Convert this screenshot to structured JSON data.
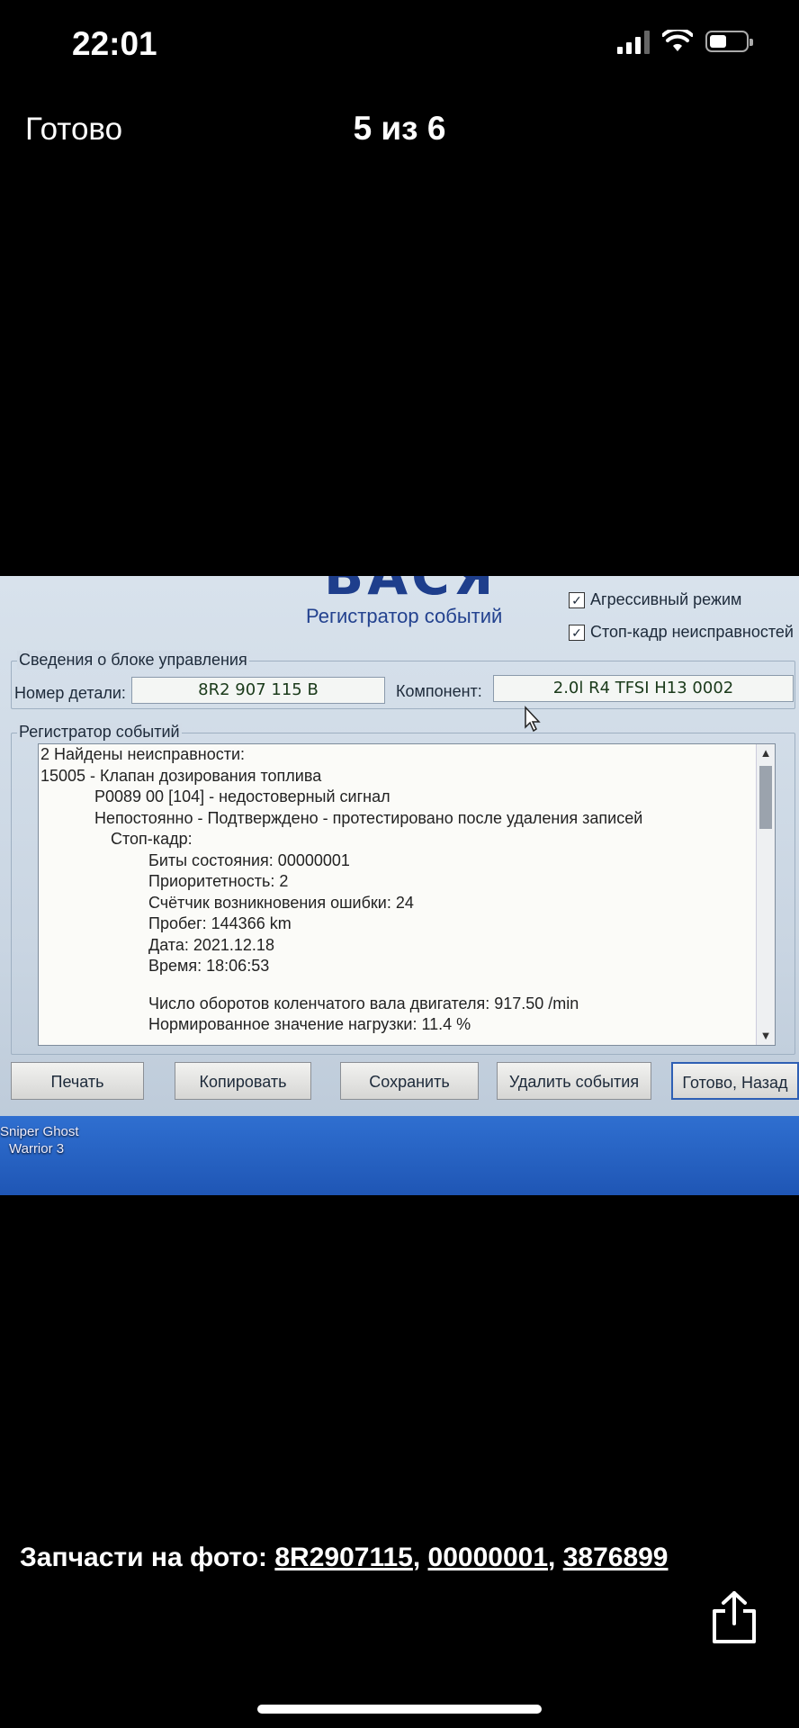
{
  "status_bar": {
    "time": "22:01"
  },
  "nav": {
    "done_label": "Готово",
    "counter": "5 из 6"
  },
  "screen": {
    "logo": "ВАСЯ",
    "title": "Регистратор событий",
    "checkbox_aggressive": {
      "label": "Агрессивный режим",
      "checked": true
    },
    "checkbox_freeze": {
      "label": "Стоп-кадр неисправностей",
      "checked": true
    },
    "ecu_group_label": "Сведения о блоке управления",
    "part_label": "Номер детали:",
    "part_value": "8R2 907 115 B",
    "component_label": "Компонент:",
    "component_value": "2.0l R4 TFSI  H13 0002",
    "log_group_label": "Регистратор событий",
    "log_lines": [
      "2 Найдены неисправности:",
      "15005 - Клапан дозирования топлива",
      "P0089 00 [104] - недостоверный сигнал",
      "Непостоянно - Подтверждено - протестировано после удаления записей",
      "Стоп-кадр:",
      "Биты состояния: 00000001",
      "Приоритетность: 2",
      "Счётчик возникновения ошибки: 24",
      "Пробег: 144366 km",
      "Дата: 2021.12.18",
      "Время: 18:06:53",
      "",
      "Число оборотов коленчатого вала двигателя: 917.50 /min",
      "Нормированное значение нагрузки: 11.4 %"
    ],
    "buttons": {
      "print": "Печать",
      "copy": "Копировать",
      "save": "Сохранить",
      "delete": "Удалить события",
      "done_back": "Готово, Назад"
    },
    "desktop_icon_label_1": "Sniper Ghost",
    "desktop_icon_label_2": "Warrior 3"
  },
  "parts": {
    "prefix": "Запчасти на фото: ",
    "links": [
      "8R2907115",
      "00000001",
      "3876899"
    ]
  }
}
